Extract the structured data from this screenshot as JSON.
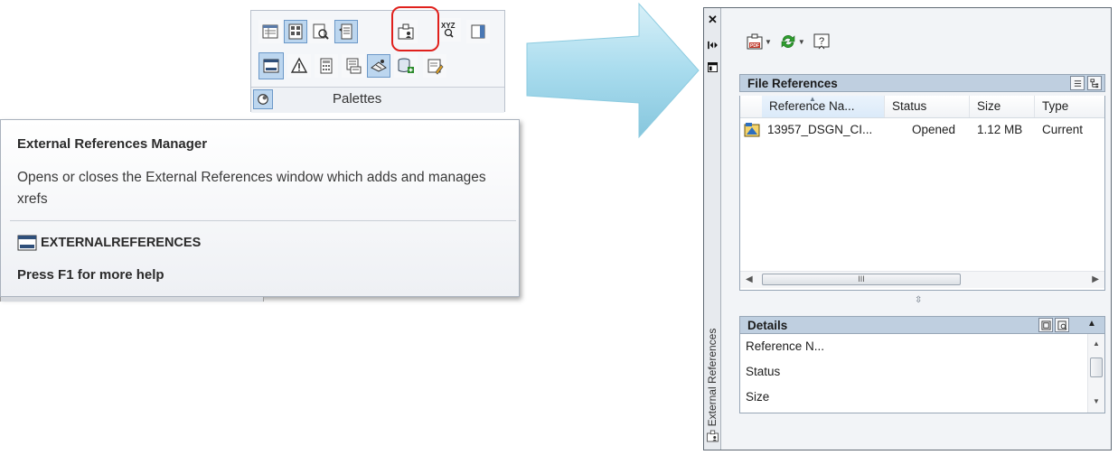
{
  "ribbon": {
    "panel_label": "Palettes",
    "row1_icons": [
      "properties-icon",
      "design-center-icon",
      "sheet-set-manager-icon",
      "tool-palettes-icon",
      "external-references-icon",
      "xyz-quick-calc-icon",
      "markup-set-icon"
    ],
    "row2_icons": [
      "command-line-icon",
      "markup-icon",
      "quickcalc-calculator-icon",
      "dbconnect-icon",
      "external-references-toolbar-icon",
      "data-source-add-icon",
      "block-editor-icon"
    ],
    "xyz_label": "XYZ"
  },
  "tooltip": {
    "title": "External References Manager",
    "description": "Opens or closes the External References window which adds and manages xrefs",
    "command": "EXTERNALREFERENCES",
    "help": "Press F1 for more help"
  },
  "palette": {
    "vertical_title": "External References",
    "close_glyph": "✕",
    "file_references": {
      "title": "File References",
      "columns": [
        "Reference Na...",
        "Status",
        "Size",
        "Type"
      ],
      "rows": [
        {
          "name": "13957_DSGN_CI...",
          "status": "Opened",
          "size": "1.12 MB",
          "type": "Current"
        }
      ],
      "scroll_thumb": "III"
    },
    "details": {
      "title": "Details",
      "rows": [
        "Reference N...",
        "Status",
        "Size"
      ]
    }
  },
  "colors": {
    "highlight": "#e0201c",
    "header_bg": "#bfcfe0",
    "arrow": "#a9dcee"
  }
}
